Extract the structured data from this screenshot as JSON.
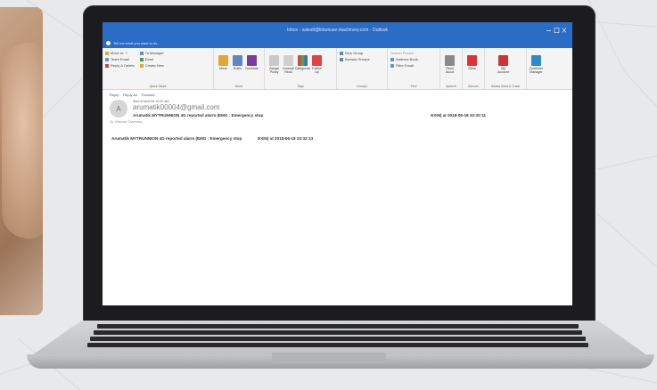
{
  "window": {
    "title": "Inbox - sales8@lidamuse-machinery.com - Outlook"
  },
  "tell_me": {
    "placeholder": "Tell me what you want to do"
  },
  "ribbon": {
    "quick_steps": {
      "items": [
        "Move to: ?",
        "To Manager",
        "Team Email",
        "Done",
        "Reply & Delete",
        "Create New"
      ],
      "group_label": "Quick Steps"
    },
    "move": {
      "buttons": [
        "Move",
        "Rules",
        "OneNote"
      ],
      "group_label": "Move"
    },
    "tags": {
      "buttons": [
        "Assign Policy",
        "Unread/ Read",
        "Categorize",
        "Follow Up"
      ],
      "group_label": "Tags"
    },
    "groups": {
      "items": [
        "New Group",
        "Browse Groups"
      ],
      "group_label": "Groups"
    },
    "find": {
      "items": [
        "Search People",
        "Address Book",
        "Filter Email"
      ],
      "group_label": "Find"
    },
    "speech": {
      "button": "Read Aloud",
      "group_label": "Speech"
    },
    "addins": {
      "button": "Store",
      "group_label": "Add-ins"
    },
    "adobe": {
      "button": "My Account",
      "group_label": "Adobe Send & Track"
    },
    "customer": {
      "button": "Customer Manager"
    }
  },
  "message": {
    "actions": [
      "Reply",
      "Reply All",
      "Forward"
    ],
    "avatar_letter": "A",
    "date": "Wed 6/18/2018 10:32 AM",
    "sender": "arumatik00004@gmail.com",
    "subject_left": "Arumatik MYTRUNNION 4G reported alarm (EMG : Emergency stop",
    "subject_right": "EXIN) at 2018-06-18 10:32:11",
    "to_label": "To",
    "to_value": "Director Overview",
    "body_left": "Arumatik MYTRUNNION 4G reported alarm (EMG : Emergency stop",
    "body_right": "EXIN) at 2018-06-18 10:32:13"
  }
}
